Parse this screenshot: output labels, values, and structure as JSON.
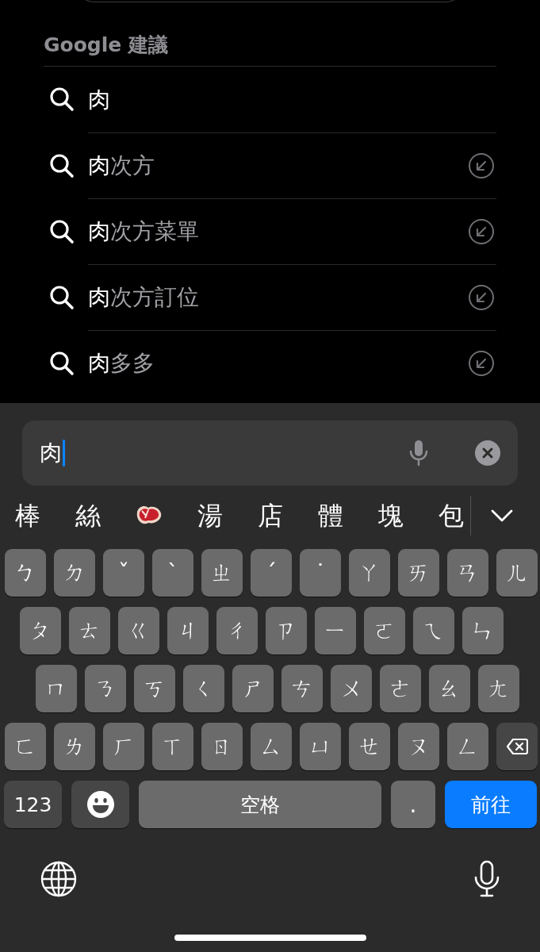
{
  "header": "Google 建議",
  "suggestions": [
    {
      "typed": "肉",
      "fill_button": false
    },
    {
      "typed": "肉",
      "completion": "次方",
      "fill_button": true
    },
    {
      "typed": "肉",
      "completion": "次方菜單",
      "fill_button": true
    },
    {
      "typed": "肉",
      "completion": "次方訂位",
      "fill_button": true
    },
    {
      "typed": "肉",
      "completion": "多多",
      "fill_button": true
    }
  ],
  "input": {
    "value": "肉"
  },
  "candidates": [
    {
      "kind": "text",
      "text": "棒"
    },
    {
      "kind": "text",
      "text": "絲"
    },
    {
      "kind": "emoji"
    },
    {
      "kind": "text",
      "text": "湯"
    },
    {
      "kind": "text",
      "text": "店"
    },
    {
      "kind": "text",
      "text": "體"
    },
    {
      "kind": "text",
      "text": "塊"
    },
    {
      "kind": "text",
      "text": "包"
    }
  ],
  "key_rows": [
    [
      {
        "kind": "char",
        "text": "ㄅ"
      },
      {
        "kind": "char",
        "text": "ㄉ"
      },
      {
        "kind": "char",
        "text": "ˇ"
      },
      {
        "kind": "char",
        "text": "ˋ"
      },
      {
        "kind": "char",
        "text": "ㄓ"
      },
      {
        "kind": "char",
        "text": "ˊ"
      },
      {
        "kind": "char",
        "text": "˙"
      },
      {
        "kind": "char",
        "text": "ㄚ"
      },
      {
        "kind": "char",
        "text": "ㄞ"
      },
      {
        "kind": "char",
        "text": "ㄢ"
      },
      {
        "kind": "char",
        "text": "ㄦ"
      }
    ],
    [
      {
        "kind": "char",
        "text": "ㄆ"
      },
      {
        "kind": "char",
        "text": "ㄊ"
      },
      {
        "kind": "char",
        "text": "ㄍ"
      },
      {
        "kind": "char",
        "text": "ㄐ"
      },
      {
        "kind": "char",
        "text": "ㄔ"
      },
      {
        "kind": "char",
        "text": "ㄗ"
      },
      {
        "kind": "char",
        "text": "ㄧ"
      },
      {
        "kind": "char",
        "text": "ㄛ"
      },
      {
        "kind": "char",
        "text": "ㄟ"
      },
      {
        "kind": "char",
        "text": "ㄣ"
      }
    ],
    [
      {
        "kind": "char",
        "text": "ㄇ"
      },
      {
        "kind": "char",
        "text": "ㄋ"
      },
      {
        "kind": "char",
        "text": "ㄎ"
      },
      {
        "kind": "char",
        "text": "ㄑ"
      },
      {
        "kind": "char",
        "text": "ㄕ"
      },
      {
        "kind": "char",
        "text": "ㄘ"
      },
      {
        "kind": "char",
        "text": "ㄨ"
      },
      {
        "kind": "char",
        "text": "ㄜ"
      },
      {
        "kind": "char",
        "text": "ㄠ"
      },
      {
        "kind": "char",
        "text": "ㄤ"
      }
    ],
    [
      {
        "kind": "char",
        "text": "ㄈ"
      },
      {
        "kind": "char",
        "text": "ㄌ"
      },
      {
        "kind": "char",
        "text": "ㄏ"
      },
      {
        "kind": "char",
        "text": "ㄒ"
      },
      {
        "kind": "char",
        "text": "ㄖ"
      },
      {
        "kind": "char",
        "text": "ㄙ"
      },
      {
        "kind": "char",
        "text": "ㄩ"
      },
      {
        "kind": "char",
        "text": "ㄝ"
      },
      {
        "kind": "char",
        "text": "ㄡ"
      },
      {
        "kind": "char",
        "text": "ㄥ"
      },
      {
        "kind": "delete"
      }
    ],
    [
      {
        "kind": "mode",
        "text": "123"
      },
      {
        "kind": "emoji"
      },
      {
        "kind": "space",
        "text": "空格"
      },
      {
        "kind": "char",
        "text": "."
      },
      {
        "kind": "primary",
        "text": "前往"
      }
    ]
  ]
}
